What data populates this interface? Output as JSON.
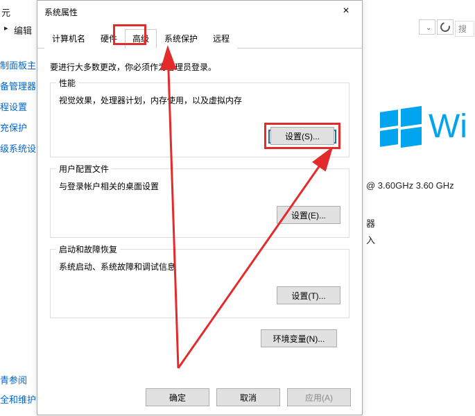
{
  "bg": {
    "topnav_item": "元",
    "edit_crumb": "编辑",
    "sidebar": [
      "制面板主页",
      "备管理器",
      "程设置",
      "充保护",
      "级系统设置"
    ],
    "footer1": "青参阅",
    "footer2": "全和维护",
    "search_placeholder": "搜",
    "spec_ghz": "@ 3.60GHz   3.60 GHz",
    "spec_label1": "器",
    "spec_label2": "入",
    "win_text": "Wi"
  },
  "dialog": {
    "title": "系统属性",
    "close": "×",
    "tabs": [
      "计算机名",
      "硬件",
      "高级",
      "系统保护",
      "远程"
    ],
    "active_tab_index": 2,
    "intro": "要进行大多数更改，你必须作为管理员登录。",
    "group_performance": {
      "title": "性能",
      "desc": "视觉效果，处理器计划，内存使用，以及虚拟内存",
      "button": "设置(S)..."
    },
    "group_userprofile": {
      "title": "用户配置文件",
      "desc": "与登录帐户相关的桌面设置",
      "button": "设置(E)..."
    },
    "group_startup": {
      "title": "启动和故障恢复",
      "desc": "系统启动、系统故障和调试信息",
      "button": "设置(T)..."
    },
    "env_button": "环境变量(N)...",
    "ok": "确定",
    "cancel": "取消",
    "apply": "应用(A)"
  }
}
